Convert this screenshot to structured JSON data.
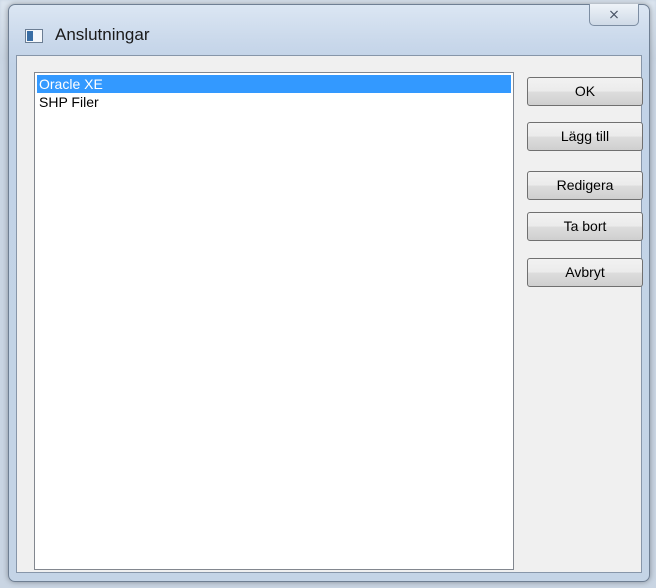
{
  "window": {
    "title": "Anslutningar",
    "close_label": "⨯"
  },
  "list": {
    "items": [
      {
        "label": "Oracle XE",
        "selected": true
      },
      {
        "label": "SHP Filer",
        "selected": false
      }
    ]
  },
  "buttons": {
    "ok": "OK",
    "add": "Lägg till",
    "edit": "Redigera",
    "remove": "Ta bort",
    "cancel": "Avbryt"
  },
  "colors": {
    "selection": "#3399ff",
    "dialog_background": "#f0f0f0"
  }
}
